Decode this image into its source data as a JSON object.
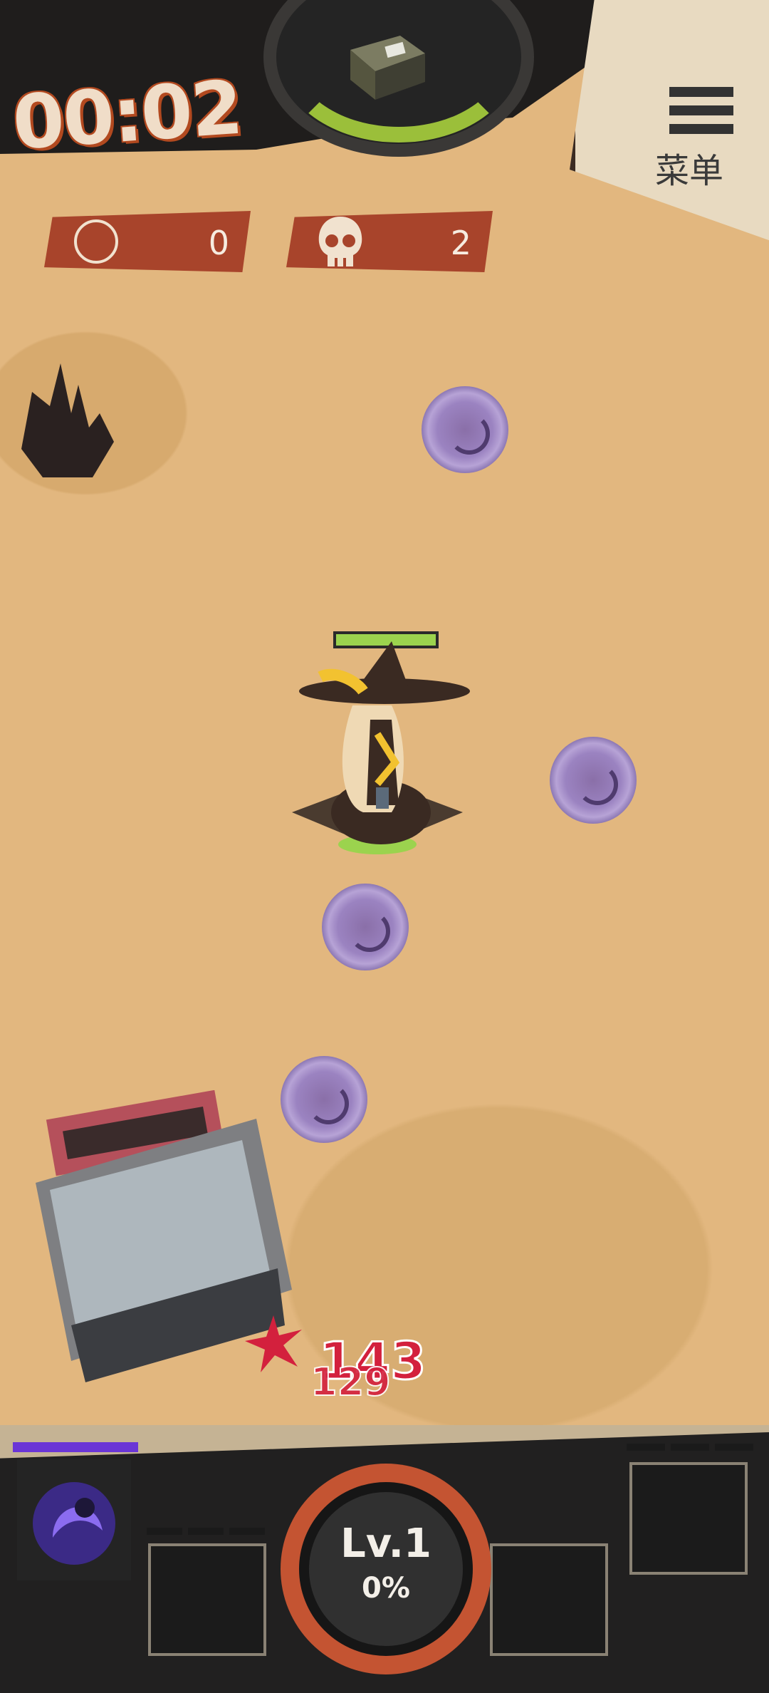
{
  "hud_top": {
    "timer": "00:02",
    "coins": "0",
    "kills": "2",
    "menu_label": "菜单"
  },
  "combat": {
    "damage_numbers": [
      "143",
      "129"
    ]
  },
  "hud_bottom": {
    "level_label": "Lv.1",
    "level_progress": "0%",
    "xp_fraction": 0
  },
  "colors": {
    "sand": "#e2b77f",
    "accent_red": "#a8442b",
    "xp_purple": "#6a35d6",
    "hp_green": "#9bd34e",
    "damage_red": "#d3203d"
  },
  "icons": [
    "coin-icon",
    "skull-icon",
    "menu-icon",
    "fire-icon",
    "vortex-orb",
    "skill-icon"
  ]
}
